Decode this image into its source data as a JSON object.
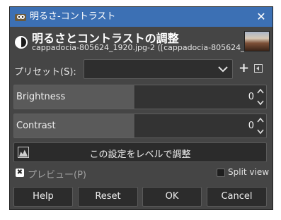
{
  "window": {
    "title": "明るさ-コントラスト",
    "close_glyph": "✕",
    "icon": "gimp-app-icon"
  },
  "header": {
    "title": "明るさとコントラストの調整",
    "subtitle": "cappadocia-805624_1920.jpg-2 ([cappadocia-805624_19...",
    "icon": "brightness-contrast-icon"
  },
  "presets": {
    "label": "プリセット(S):",
    "value": "",
    "add_glyph": "+"
  },
  "brightness": {
    "label": "Brightness",
    "value": "0"
  },
  "contrast": {
    "label": "Contrast",
    "value": "0"
  },
  "levels_button": {
    "label": "この設定をレベルで調整"
  },
  "preview": {
    "label": "プレビュー(P)",
    "checked": true,
    "check_glyph": "✖"
  },
  "split_view": {
    "label": "Split view",
    "checked": false
  },
  "buttons": {
    "help": "Help",
    "reset": "Reset",
    "ok": "OK",
    "cancel": "Cancel"
  },
  "colors": {
    "titlebar": "#3c70b4",
    "dialog_bg": "#454545",
    "field_bg": "#333333",
    "text": "#efefef"
  }
}
